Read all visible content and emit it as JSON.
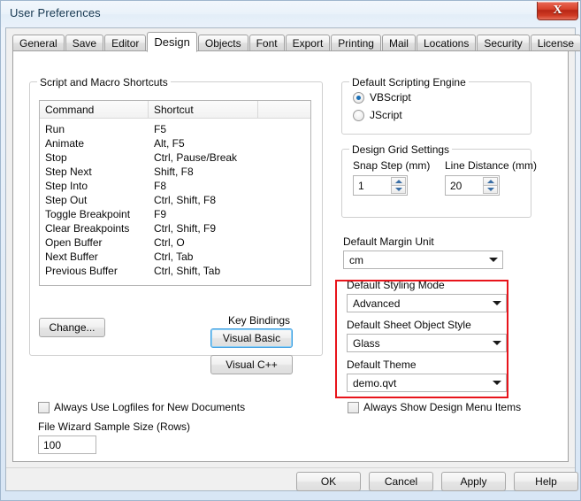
{
  "window": {
    "title": "User Preferences",
    "close_label": "X",
    "accent_color": "#e8141b",
    "titlebar_color": "#e9f1fa",
    "close_color": "#c23a22"
  },
  "tabs": [
    {
      "label": "General",
      "active": false
    },
    {
      "label": "Save",
      "active": false
    },
    {
      "label": "Editor",
      "active": false
    },
    {
      "label": "Design",
      "active": true
    },
    {
      "label": "Objects",
      "active": false
    },
    {
      "label": "Font",
      "active": false
    },
    {
      "label": "Export",
      "active": false
    },
    {
      "label": "Printing",
      "active": false
    },
    {
      "label": "Mail",
      "active": false
    },
    {
      "label": "Locations",
      "active": false
    },
    {
      "label": "Security",
      "active": false
    },
    {
      "label": "License",
      "active": false
    }
  ],
  "script_macro_group": {
    "legend": "Script and Macro Shortcuts",
    "table": {
      "columns": [
        "Command",
        "Shortcut",
        ""
      ],
      "rows": [
        [
          "Run",
          "F5",
          ""
        ],
        [
          "Animate",
          "Alt, F5",
          ""
        ],
        [
          "Stop",
          "Ctrl, Pause/Break",
          ""
        ],
        [
          "Step Next",
          "Shift, F8",
          ""
        ],
        [
          "Step Into",
          "F8",
          ""
        ],
        [
          "Step Out",
          "Ctrl, Shift, F8",
          ""
        ],
        [
          "Toggle Breakpoint",
          "F9",
          ""
        ],
        [
          "Clear Breakpoints",
          "Ctrl, Shift, F9",
          ""
        ],
        [
          "Open Buffer",
          "Ctrl, O",
          ""
        ],
        [
          "Next Buffer",
          "Ctrl, Tab",
          ""
        ],
        [
          "Previous Buffer",
          "Ctrl, Shift, Tab",
          ""
        ]
      ]
    },
    "change_button": "Change...",
    "key_bindings_label": "Key Bindings",
    "visual_basic_button": "Visual Basic",
    "visual_cpp_button": "Visual C++"
  },
  "logfiles_checkbox": {
    "label": "Always Use Logfiles for New Documents",
    "checked": false
  },
  "file_wizard": {
    "label": "File Wizard Sample Size (Rows)",
    "value": "100"
  },
  "scripting_engine_group": {
    "legend": "Default Scripting Engine",
    "options": [
      {
        "label": "VBScript",
        "selected": true
      },
      {
        "label": "JScript",
        "selected": false
      }
    ]
  },
  "grid_settings_group": {
    "legend": "Design Grid Settings",
    "snap_step": {
      "label": "Snap Step (mm)",
      "value": "1"
    },
    "line_distance": {
      "label": "Line Distance (mm)",
      "value": "20"
    }
  },
  "margin_unit": {
    "label": "Default Margin Unit",
    "value": "cm"
  },
  "styling_mode": {
    "label": "Default Styling Mode",
    "value": "Advanced"
  },
  "sheet_object_style": {
    "label": "Default Sheet Object Style",
    "value": "Glass"
  },
  "default_theme": {
    "label": "Default Theme",
    "value": "demo.qvt"
  },
  "design_menu_checkbox": {
    "label": "Always Show Design Menu Items",
    "checked": false
  },
  "bottom_buttons": [
    {
      "label": "OK"
    },
    {
      "label": "Cancel"
    },
    {
      "label": "Apply"
    },
    {
      "label": "Help"
    }
  ]
}
